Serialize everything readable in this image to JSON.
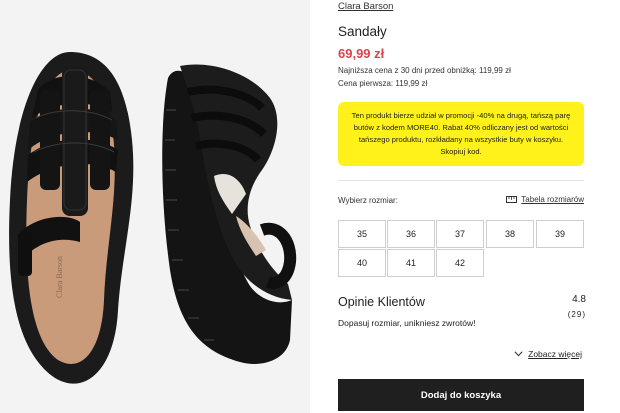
{
  "product": {
    "brand": "Clara Barson",
    "title": "Sandały",
    "price": "69,99 zł",
    "lowest_price_note": "Najniższa cena z 30 dni przed obniżką: 119,99 zł",
    "first_price_note": "Cena pierwsza: 119,99 zł",
    "image_alt": "Czarne sandały - widok z góry i z boku",
    "insole_brand": "Clara Barson"
  },
  "promo": {
    "text": "Ten produkt bierze udział w promocji -40% na drugą, tańszą parę butów z kodem MORE40. Rabat 40% odliczany jest od wartości tańszego produktu, rozkładany na wszystkie buty w koszyku. Skopiuj kod.",
    "color": "#fff11a"
  },
  "size_select": {
    "label": "Wybierz rozmiar:",
    "size_table_label": "Tabela rozmiarów",
    "size_table_icon": "ruler-icon",
    "sizes": [
      "35",
      "36",
      "37",
      "38",
      "39",
      "40",
      "41",
      "42"
    ]
  },
  "reviews": {
    "title": "Opinie Klientów",
    "rating": "4.8",
    "count": "(29)",
    "snippet": "Dopasuj rozmiar, unikniesz zwrotów!",
    "more_label": "Zobacz więcej",
    "more_icon": "chevron-down-icon"
  },
  "cart": {
    "button_label": "Dodaj do koszyka"
  },
  "colors": {
    "price": "#e0424c",
    "button_bg": "#1f1f1f"
  }
}
